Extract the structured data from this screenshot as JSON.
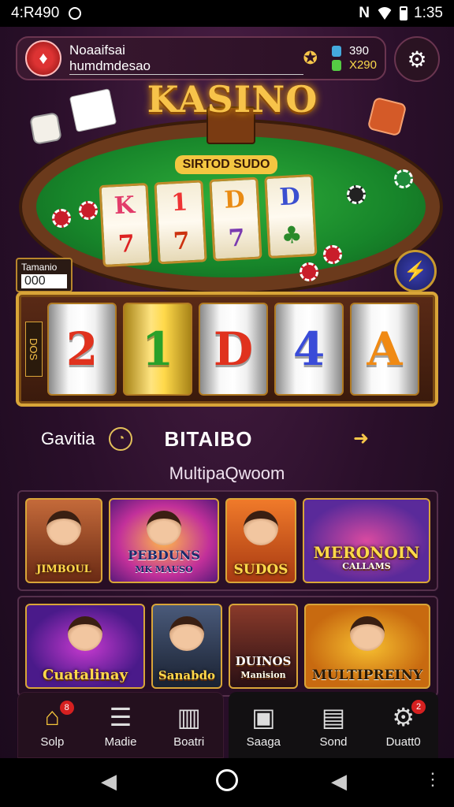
{
  "status_bar": {
    "time": "4:R490",
    "right_time": "1:35"
  },
  "header": {
    "user_name": "Noaaifsai",
    "user_sub": "humdmdesao",
    "balance_1": "390",
    "balance_2": "X290"
  },
  "hero": {
    "title": "KASINO",
    "sign": "SIRTOD SUDO",
    "mini_reels": [
      "K",
      "1",
      "D",
      "D"
    ],
    "left_label_title": "Tamanio",
    "left_label_value": "000",
    "side_label": "DOS"
  },
  "reels": [
    "2",
    "1",
    "D",
    "4",
    "A"
  ],
  "info": {
    "left": "Gavitia",
    "title": "BITAIBO"
  },
  "section_title": "MultipaQwoom",
  "games_row_1": [
    {
      "title": "JIMBOUL",
      "sub": ""
    },
    {
      "title": "PEBDUNS",
      "sub": "MK MAUSO"
    },
    {
      "title": "SUDOS",
      "sub": ""
    },
    {
      "title": "MERONOIN",
      "sub": "CALLAMS"
    }
  ],
  "games_row_2": [
    {
      "title": "Cuatalinay",
      "sub": ""
    },
    {
      "title": "Sanabdo",
      "sub": ""
    },
    {
      "title": "DUINOS",
      "sub": "Manision"
    },
    {
      "title": "MULTIPREINY",
      "sub": ""
    }
  ],
  "nav": [
    {
      "label": "Solp",
      "icon": "home-icon",
      "badge": "8"
    },
    {
      "label": "Madie",
      "icon": "stack-icon",
      "badge": ""
    },
    {
      "label": "Boatri",
      "icon": "chart-icon",
      "badge": ""
    },
    {
      "label": "Saaga",
      "icon": "screen-icon",
      "badge": ""
    },
    {
      "label": "Sond",
      "icon": "wallet-icon",
      "badge": ""
    },
    {
      "label": "Duatt0",
      "icon": "gear-icon",
      "badge": "2"
    }
  ],
  "colors": {
    "accent": "#f4c43a",
    "background": "#2a0f2a",
    "table": "#17852a"
  }
}
